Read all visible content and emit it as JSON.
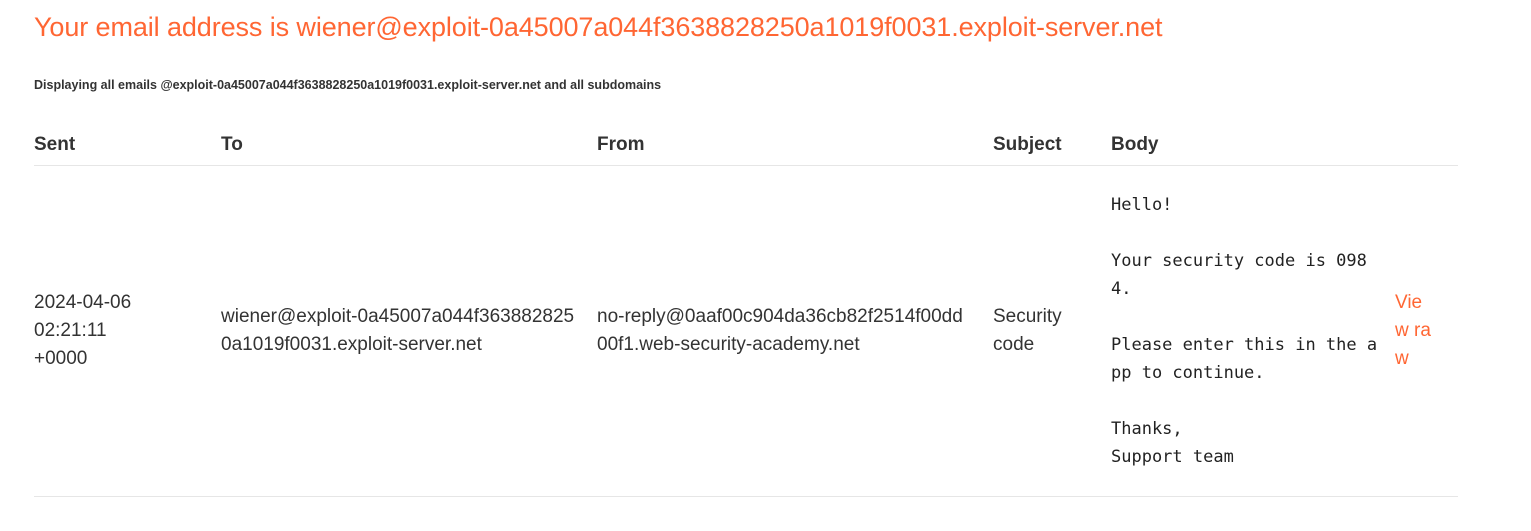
{
  "page": {
    "title": "Your email address is wiener@exploit-0a45007a044f3638828250a1019f0031.exploit-server.net",
    "subtitle": "Displaying all emails @exploit-0a45007a044f3638828250a1019f0031.exploit-server.net and all subdomains"
  },
  "table": {
    "headers": {
      "sent": "Sent",
      "to": "To",
      "from": "From",
      "subject": "Subject",
      "body": "Body"
    },
    "rows": [
      {
        "sent": "2024-04-06 02:21:11 +0000",
        "to": "wiener@exploit-0a45007a044f3638828250a1019f0031.exploit-server.net",
        "from": "no-reply@0aaf00c904da36cb82f2514f00dd00f1.web-security-academy.net",
        "subject": "Security code",
        "body": "Hello!\n\nYour security code is 0984.\n\nPlease enter this in the app to continue.\n\nThanks,\nSupport team",
        "action": "View raw"
      }
    ]
  },
  "colors": {
    "accent": "#ff6633",
    "text": "#333333",
    "divider": "#e6e6e6"
  }
}
